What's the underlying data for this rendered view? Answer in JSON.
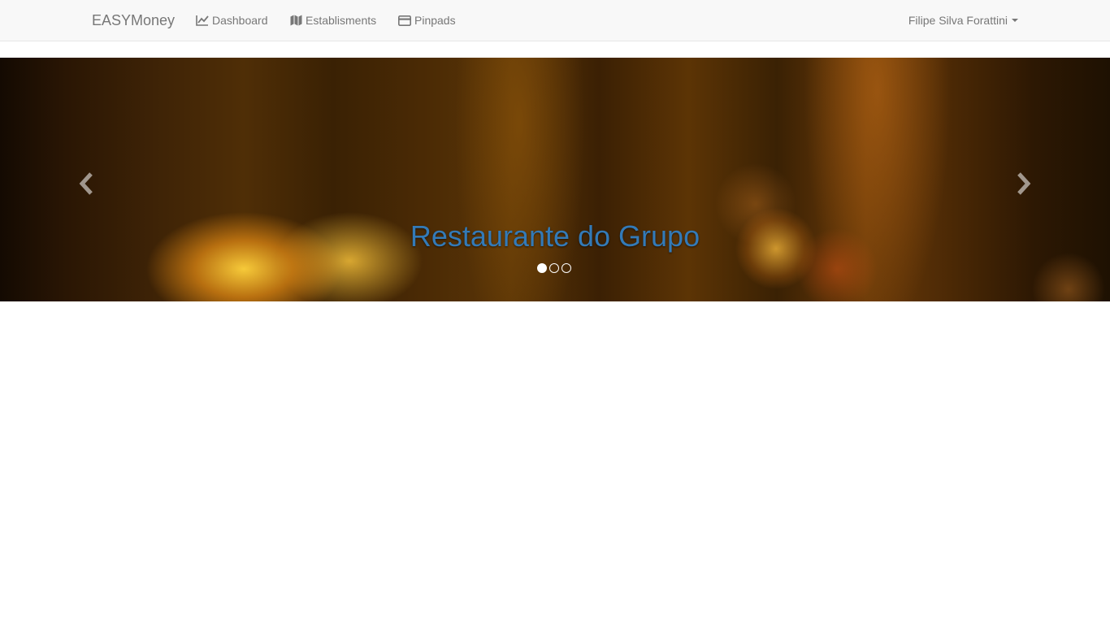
{
  "navbar": {
    "brand": "EASYMoney",
    "links": [
      {
        "label": "Dashboard",
        "icon": "line-chart-icon"
      },
      {
        "label": "Establisments",
        "icon": "map-icon"
      },
      {
        "label": "Pinpads",
        "icon": "credit-card-icon"
      }
    ],
    "user": "Filipe Silva Forattini"
  },
  "carousel": {
    "caption": "Restaurante do Grupo",
    "active_slide": 1,
    "slide_count": 3,
    "caption_color": "#337ab7"
  }
}
